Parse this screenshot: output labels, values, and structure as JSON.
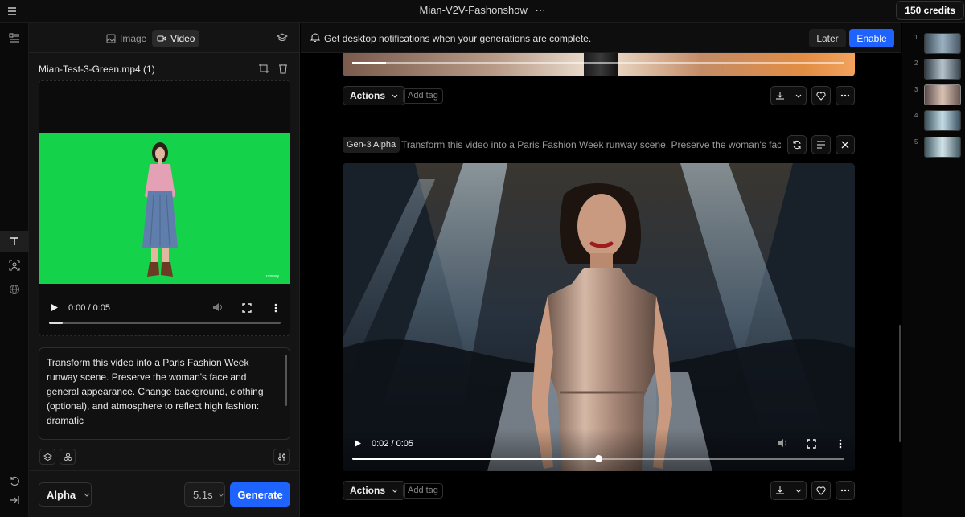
{
  "topbar": {
    "title": "Mian-V2V-Fashonshow",
    "more_glyph": "···",
    "credits": "150 credits"
  },
  "mode_tabs": {
    "image": "Image",
    "video": "Video"
  },
  "left_panel": {
    "file_name": "Mian-Test-3-Green.mp4 (1)",
    "watermark": "runway",
    "video_time": "0:00 / 0:05",
    "video_progress": 0.06,
    "prompt": "Transform this video into a Paris Fashion Week runway scene. Preserve the woman's face and general appearance. Change background, clothing (optional), and atmosphere to reflect high fashion: dramatic",
    "model": "Alpha",
    "duration": "5.1s",
    "generate_label": "Generate"
  },
  "notification": {
    "text": "Get desktop notifications when your generations are complete.",
    "later": "Later",
    "enable": "Enable"
  },
  "feed": {
    "actions_label": "Actions",
    "add_tag_label": "Add tag",
    "generation": {
      "model_badge": "Gen-3 Alpha",
      "prompt": "Transform this video into a Paris Fashion Week runway scene. Preserve the woman's face and general appearance..."
    },
    "main_video_time": "0:02 / 0:05",
    "main_video_progress": 0.5
  },
  "thumbnails": [
    "1",
    "2",
    "3",
    "4",
    "5"
  ],
  "colors": {
    "accent": "#1f63ff",
    "chroma_green": "#14d34a"
  },
  "icons": [
    "menu-icon",
    "grid-icon",
    "text-icon",
    "face-icon",
    "globe-icon",
    "undo-icon",
    "collapse-icon",
    "crop-icon",
    "trash-icon",
    "bell-icon",
    "download-icon",
    "heart-icon",
    "refresh-icon",
    "close-icon"
  ]
}
